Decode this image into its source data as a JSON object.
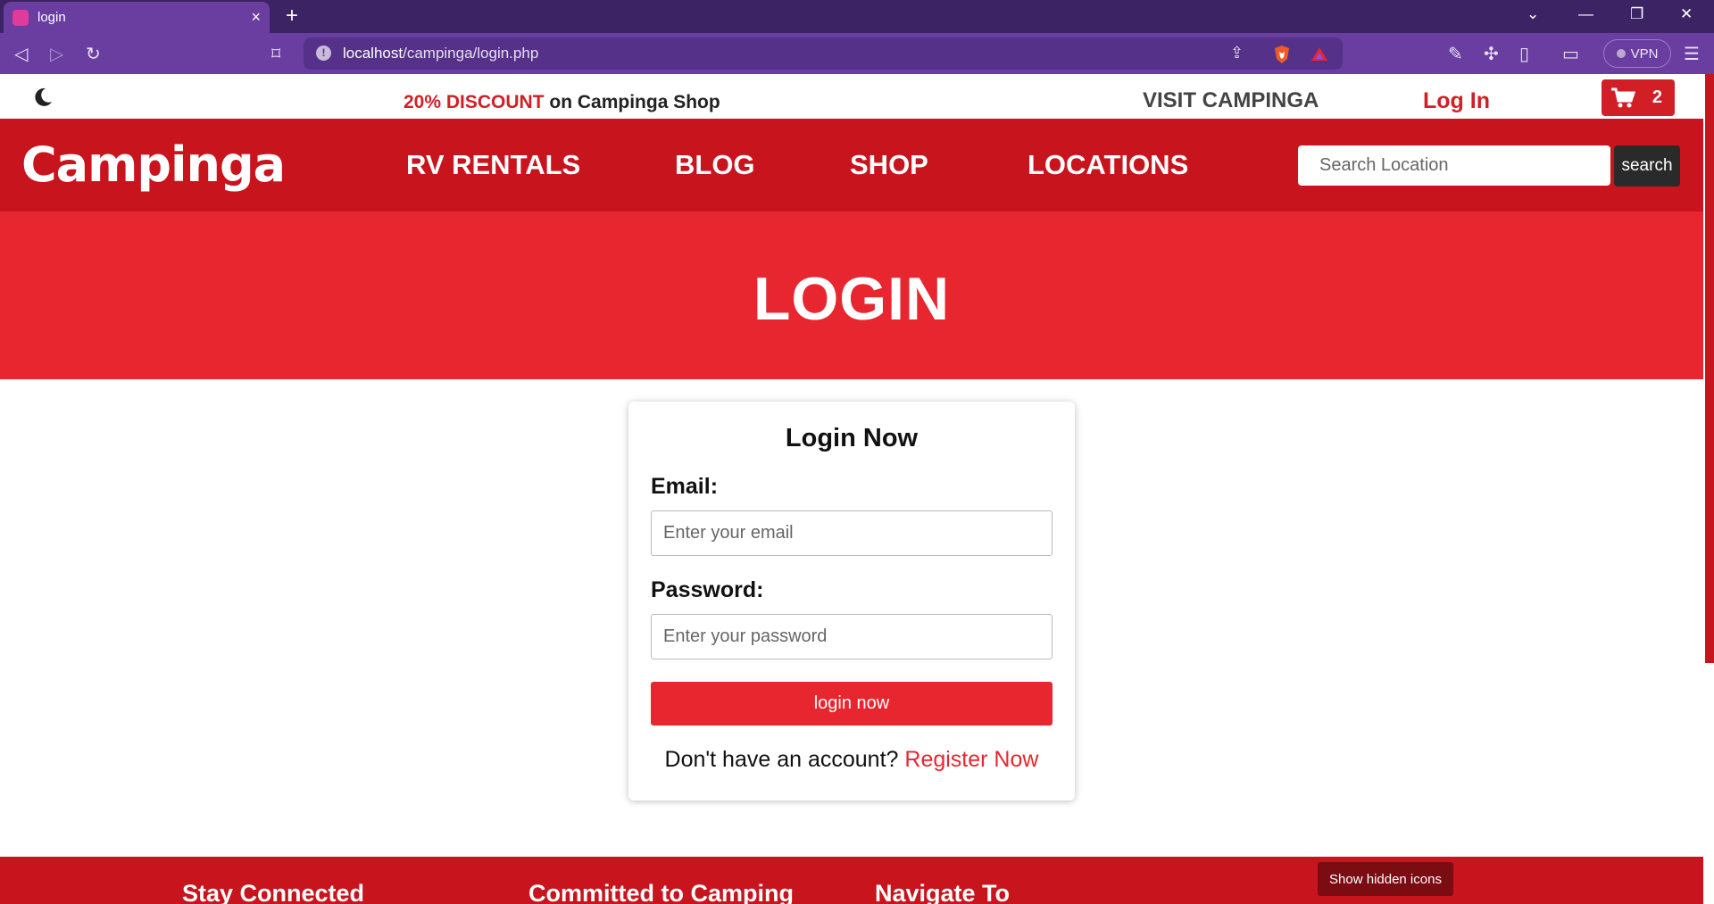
{
  "browser": {
    "tab_title": "login",
    "url_host": "localhost",
    "url_path": "/campinga/login.php",
    "vpn_label": "VPN",
    "tab_close_icon": "×",
    "new_tab_icon": "+"
  },
  "topbar": {
    "promo_highlight": "20% DISCOUNT",
    "promo_rest": " on Campinga Shop",
    "visit_link": "VISIT CAMPINGA",
    "login_link": "Log In",
    "cart_count": "2"
  },
  "nav": {
    "logo": "Campinga",
    "links": [
      "RV RENTALS",
      "BLOG",
      "SHOP",
      "LOCATIONS"
    ],
    "search_placeholder": "Search Location",
    "search_button": "search"
  },
  "hero": {
    "title": "LOGIN"
  },
  "login_form": {
    "title": "Login Now",
    "email_label": "Email:",
    "email_placeholder": "Enter your email",
    "password_label": "Password:",
    "password_placeholder": "Enter your password",
    "submit_label": "login now",
    "register_prompt": "Don't have an account? ",
    "register_link": "Register Now"
  },
  "footer": {
    "headings": [
      "Stay Connected",
      "Committed to Camping",
      "Navigate To"
    ]
  },
  "taskbar_tooltip": "Show hidden icons",
  "colors": {
    "brand_red": "#c8141d",
    "hero_red": "#e8262f",
    "browser_purple": "#6a3da1"
  }
}
